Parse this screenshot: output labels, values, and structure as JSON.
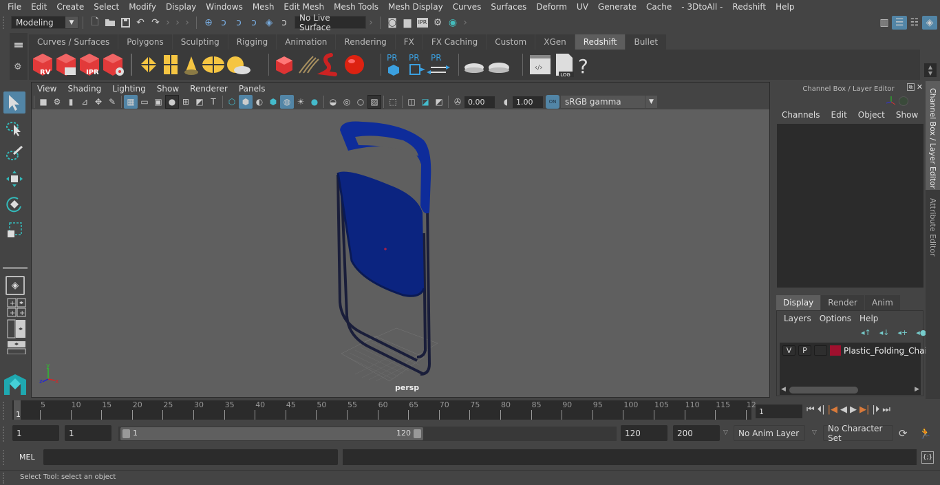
{
  "menubar": {
    "items": [
      "File",
      "Edit",
      "Create",
      "Select",
      "Modify",
      "Display",
      "Windows",
      "Mesh",
      "Edit Mesh",
      "Mesh Tools",
      "Mesh Display",
      "Curves",
      "Surfaces",
      "Deform",
      "UV",
      "Generate",
      "Cache",
      "- 3DtoAll -",
      "Redshift",
      "Help"
    ]
  },
  "statusline": {
    "mode": "Modeling",
    "live_surface": "No Live Surface"
  },
  "shelf": {
    "tabs": [
      "Curves / Surfaces",
      "Polygons",
      "Sculpting",
      "Rigging",
      "Animation",
      "Rendering",
      "FX",
      "FX Caching",
      "Custom",
      "XGen",
      "Redshift",
      "Bullet"
    ],
    "active_tab": "Redshift",
    "icons": {
      "rv": "RV",
      "ipr": "IPR",
      "pr": "PR",
      "log": ".LOG",
      "help": "?"
    }
  },
  "panel": {
    "menu": [
      "View",
      "Shading",
      "Lighting",
      "Show",
      "Renderer",
      "Panels"
    ],
    "exposure": "0.00",
    "gamma": "1.00",
    "color_space_toggle": "ON",
    "color_space": "sRGB gamma",
    "camera_label": "persp"
  },
  "axis": {
    "x": "x",
    "y": "y",
    "z": "z"
  },
  "channel_box": {
    "title": "Channel Box / Layer Editor",
    "menu": [
      "Channels",
      "Edit",
      "Object",
      "Show"
    ]
  },
  "layer_editor": {
    "tabs": [
      "Display",
      "Render",
      "Anim"
    ],
    "active_tab": "Display",
    "menu": [
      "Layers",
      "Options",
      "Help"
    ],
    "layers": [
      {
        "v": "V",
        "p": "P",
        "color": "#a0102e",
        "name": "Plastic_Folding_Chair_"
      }
    ]
  },
  "side_tabs": [
    "Channel Box / Layer Editor",
    "Attribute Editor"
  ],
  "timeline": {
    "ticks": [
      "5",
      "10",
      "15",
      "20",
      "25",
      "30",
      "35",
      "40",
      "45",
      "50",
      "55",
      "60",
      "65",
      "70",
      "75",
      "80",
      "85",
      "90",
      "95",
      "100",
      "105",
      "110",
      "115",
      "12"
    ],
    "start_marker": "1",
    "current_frame": "1"
  },
  "range": {
    "start": "1",
    "playback_start": "1",
    "slider_min": "1",
    "slider_max": "120",
    "playback_end": "120",
    "end": "200",
    "anim_layer": "No Anim Layer",
    "character_set": "No Character Set"
  },
  "command": {
    "lang": "MEL",
    "input": "",
    "output": ""
  },
  "help_line": "Select Tool: select an object",
  "colors": {
    "accent": "#5285a6",
    "chair_blue": "#0b2a8a",
    "layer_color": "#a0102e",
    "viewport_bg": "#5f5f5f"
  }
}
